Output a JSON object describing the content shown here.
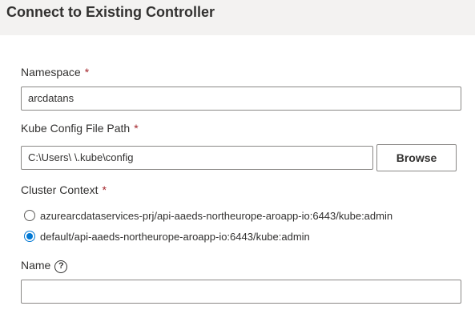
{
  "header": {
    "title": "Connect to Existing Controller"
  },
  "namespace": {
    "label": "Namespace",
    "required_mark": "*",
    "value": "arcdatans"
  },
  "kube_config": {
    "label": "Kube Config File Path",
    "required_mark": "*",
    "value": "C:\\Users\\            \\.kube\\config",
    "browse_label": "Browse"
  },
  "cluster_context": {
    "label": "Cluster Context",
    "required_mark": "*",
    "options": [
      {
        "label": "azurearcdataservices-prj/api-aaeds-northeurope-aroapp-io:6443/kube:admin",
        "selected": false
      },
      {
        "label": "default/api-aaeds-northeurope-aroapp-io:6443/kube:admin",
        "selected": true
      }
    ]
  },
  "name": {
    "label": "Name",
    "help_icon": "question-circle-icon",
    "help_glyph": "?",
    "value": ""
  },
  "colors": {
    "accent": "#0078d4",
    "required": "#a4262c",
    "header_bg": "#f3f2f1"
  }
}
